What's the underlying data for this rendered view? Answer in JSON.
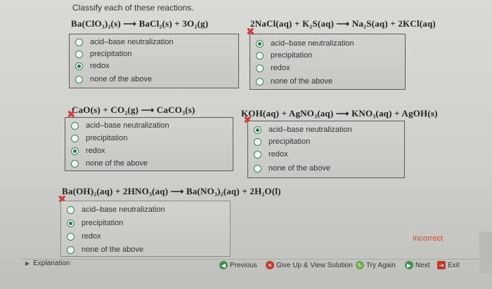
{
  "instructions": "Classify each of these reactions.",
  "options": [
    "acid–base neutralization",
    "precipitation",
    "redox",
    "none of the above"
  ],
  "questions": [
    {
      "equation": "Ba(ClO₃)₂(s)  ⟶  BaCl₂(s) + 3O₂(g)",
      "selected": 2,
      "marked_wrong": false
    },
    {
      "equation": "2NaCl(aq) + K₂S(aq)  ⟶  Na₂S(aq) + 2KCl(aq)",
      "selected": 0,
      "marked_wrong": true
    },
    {
      "equation": "CaO(s) + CO₂(g)  ⟶  CaCO₃(s)",
      "selected": 2,
      "marked_wrong": true
    },
    {
      "equation": "KOH(aq) + AgNO₃(aq)  ⟶  KNO₃(aq) + AgOH(s)",
      "selected": 0,
      "marked_wrong": true
    },
    {
      "equation": "Ba(OH)₂(aq) + 2HNO₃(aq)  ⟶  Ba(NO₃)₂(aq) + 2H₂O(l)",
      "selected": 1,
      "marked_wrong": true
    }
  ],
  "status": "Incorrect",
  "footer": {
    "explanation": "Explanation",
    "previous": "Previous",
    "give_up": "Give Up & View Solution",
    "try_again": "Try Again",
    "next": "Next",
    "exit": "Exit"
  },
  "colors": {
    "wrong_mark": "#d63b3b",
    "radio": "#1f7a3e",
    "status_incorrect": "#d0462e"
  }
}
